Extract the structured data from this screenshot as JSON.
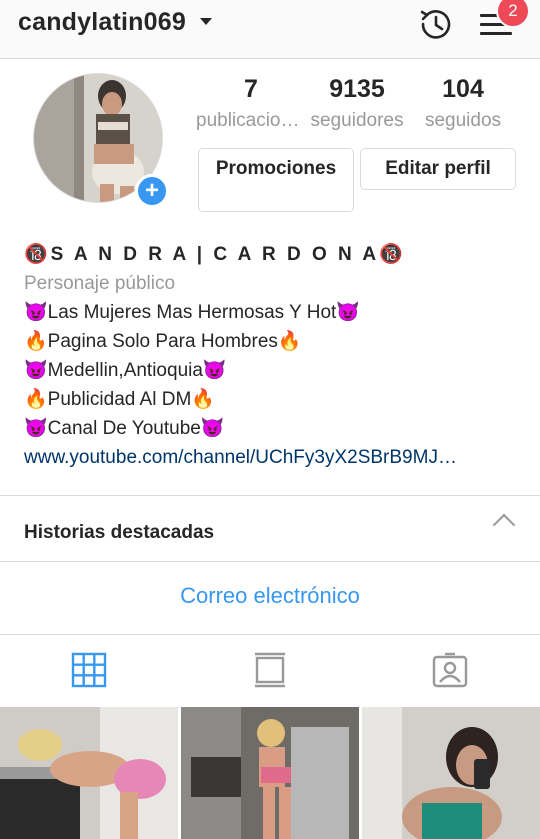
{
  "header": {
    "username": "candylatin069",
    "notification_count": "2",
    "icons": [
      "chevron-down-icon",
      "history-icon",
      "menu-icon"
    ]
  },
  "profile": {
    "stats": [
      {
        "value": "7",
        "label": "publicaciones"
      },
      {
        "value": "9135",
        "label": "seguidores"
      },
      {
        "value": "104",
        "label": "seguidos"
      }
    ],
    "promote_label": "Promociones",
    "edit_label": "Editar perfil"
  },
  "bio": {
    "name": "🔞S A N D R A | C A R D O N A🔞",
    "category": "Personaje público",
    "lines": [
      "😈Las Mujeres Mas Hermosas Y Hot😈",
      "🔥Pagina Solo Para Hombres🔥",
      "😈Medellin,Antioquia😈",
      "🔥Publicidad Al DM🔥",
      "😈Canal De Youtube😈"
    ],
    "link": "www.youtube.com/channel/UChFy3yX2SBrB9MJ…"
  },
  "highlights_label": "Historias destacadas",
  "email_label": "Correo electrónico",
  "tabs": [
    "grid-icon",
    "feed-icon",
    "tagged-icon"
  ],
  "colors": {
    "accent": "#3897f0",
    "badge": "#ed4956",
    "muted": "#999999"
  }
}
